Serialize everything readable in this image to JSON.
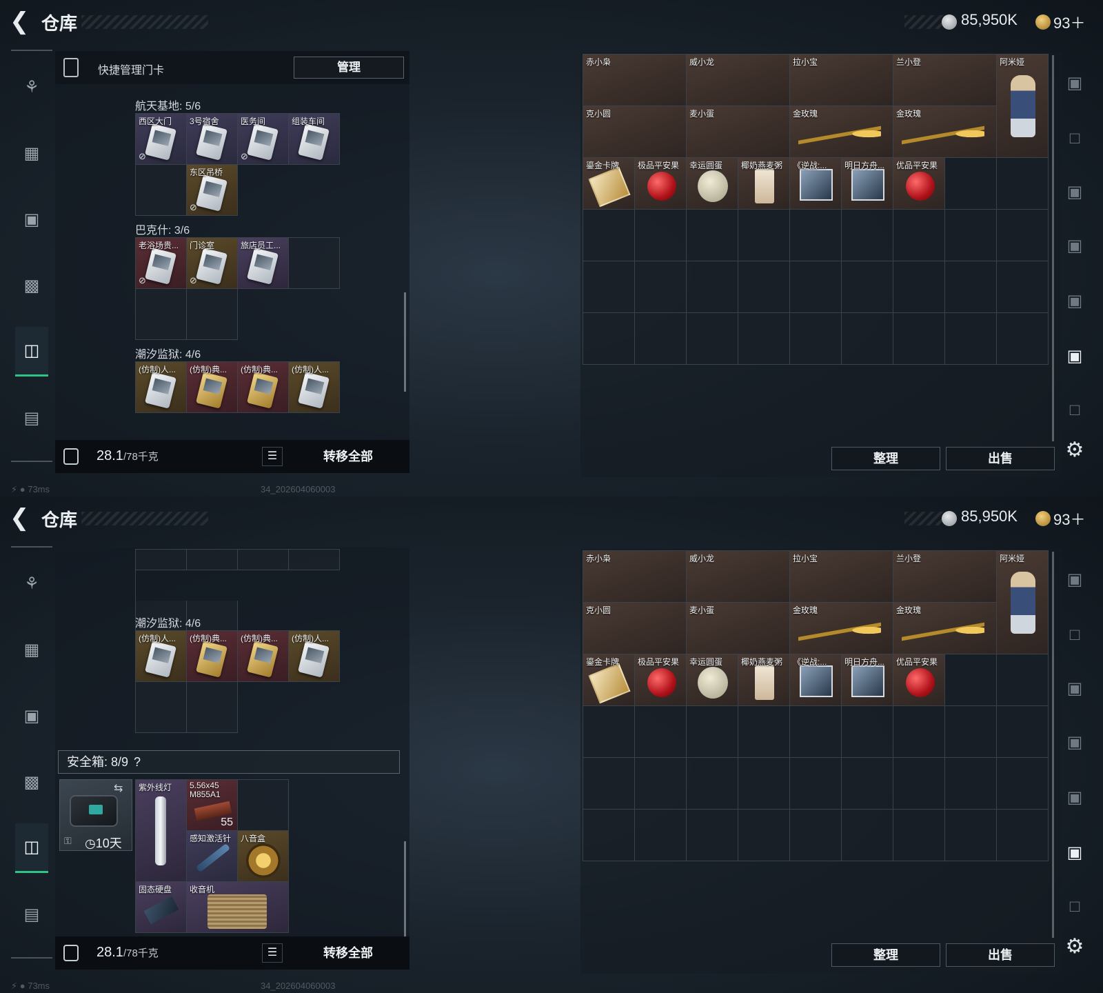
{
  "header": {
    "title": "仓库",
    "money": "85,950K",
    "tickets": "93＋"
  },
  "nav": {
    "icons": [
      "pistol-icon",
      "armor-vest-icon",
      "chest-rig-icon",
      "backpack-icon",
      "keycard-case-icon",
      "toolbox-icon"
    ],
    "active": 4
  },
  "left": {
    "quick_label": "快捷管理门卡",
    "manage_label": "管理",
    "sections": [
      {
        "title": "航天基地: 5/6",
        "items": [
          "西区大门",
          "3号宿舍",
          "医务间",
          "组装车间",
          "",
          "东区吊桥"
        ]
      },
      {
        "title": "巴克什: 3/6",
        "items": [
          "老浴场贵...",
          "门诊室",
          "旅店员工..."
        ]
      },
      {
        "title": "潮汐监狱: 4/6",
        "items": [
          "(仿制)人...",
          "(仿制)典...",
          "(仿制)典...",
          "(仿制)人..."
        ]
      }
    ],
    "weight": "28.1",
    "weight_cap": "/78千克",
    "transfer_all": "转移全部",
    "safe": {
      "header": "安全箱: 8/9",
      "help": "?",
      "days": "10天",
      "items": [
        "紫外线灯",
        "5.56x45 M855A1",
        "感知激活针",
        "八音盒",
        "固态硬盘",
        "收音机"
      ],
      "ammo_count": "55"
    }
  },
  "right": {
    "row1": [
      "赤小枭",
      "威小龙",
      "拉小宝",
      "兰小登",
      "阿米娅"
    ],
    "row2": [
      "克小圆",
      "麦小蛋",
      "金玫瑰",
      "金玫瑰"
    ],
    "row3": [
      "鎏金卡牌",
      "极品平安果",
      "幸运圆蛋",
      "椰奶燕麦粥",
      "《逆战:...",
      "明日方舟...",
      "优品平安果"
    ],
    "sort_label": "整理",
    "sell_label": "出售"
  },
  "status": {
    "ping": "73ms",
    "build": "34_202604060003"
  }
}
